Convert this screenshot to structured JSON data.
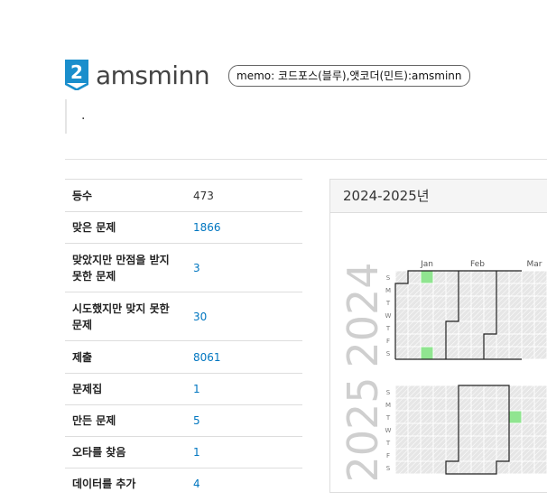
{
  "profile": {
    "rank_digit": "2",
    "username": "amsminn",
    "memo": "memo: 코드포스(블루),앳코더(민트):amsminn",
    "bio": "."
  },
  "stats": [
    {
      "label": "등수",
      "value": "473",
      "link": false
    },
    {
      "label": "맞은 문제",
      "value": "1866",
      "link": true
    },
    {
      "label": "맞았지만 만점을 받지 못한 문제",
      "value": "3",
      "link": true
    },
    {
      "label": "시도했지만 맞지 못한 문제",
      "value": "30",
      "link": true
    },
    {
      "label": "제출",
      "value": "8061",
      "link": true
    },
    {
      "label": "문제집",
      "value": "1",
      "link": true
    },
    {
      "label": "만든 문제",
      "value": "5",
      "link": true
    },
    {
      "label": "오타를 찾음",
      "value": "1",
      "link": true
    },
    {
      "label": "데이터를 추가",
      "value": "4",
      "link": true
    }
  ],
  "calendar": {
    "title": "2024-2025년",
    "months": [
      "Jan",
      "Feb",
      "Mar"
    ],
    "day_labels": [
      "S",
      "M",
      "T",
      "W",
      "T",
      "F",
      "S"
    ],
    "years": [
      {
        "label": "2024",
        "active": [
          [
            2,
            0
          ],
          [
            2,
            6
          ],
          [
            12,
            4
          ],
          [
            12,
            2
          ],
          [
            13,
            3
          ],
          [
            14,
            2
          ]
        ]
      },
      {
        "label": "2025",
        "active": [
          [
            9,
            2
          ]
        ]
      }
    ],
    "colors": {
      "active": "#90e590",
      "empty": "#e6e6e6",
      "outline": "#222222"
    }
  }
}
